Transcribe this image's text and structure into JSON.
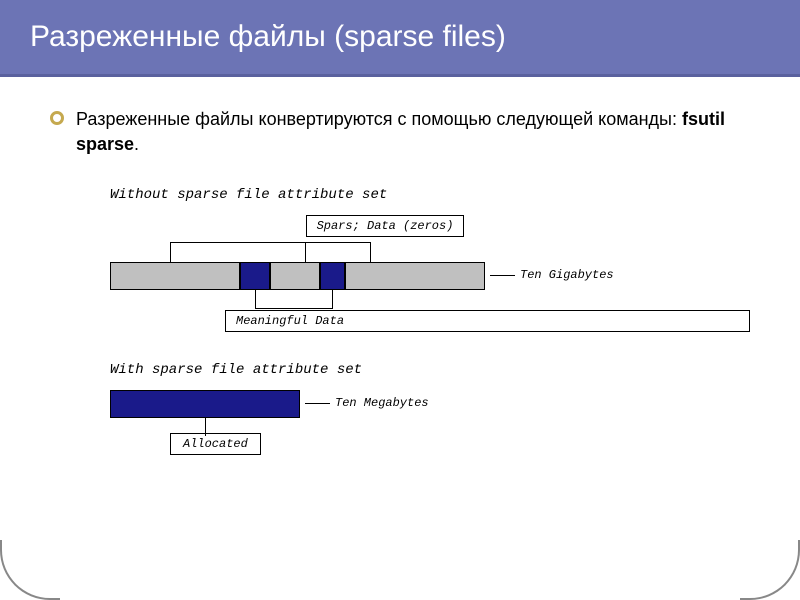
{
  "slide": {
    "title": "Разреженные файлы (sparse files)",
    "bullet_text_prefix": "Разреженные файлы конвертируются с помощью следующей команды: ",
    "bullet_text_bold": "fsutil sparse",
    "bullet_text_suffix": "."
  },
  "diagram": {
    "section1_title": "Without sparse file attribute set",
    "sparse_data_label": "Spars; Data (zeros)",
    "side_label1": "Ten Gigabytes",
    "meaningful_label": "Meaningful Data",
    "section2_title": "With sparse file attribute set",
    "side_label2": "Ten Megabytes",
    "allocated_label": "Allocated",
    "bar_segments": [
      {
        "type": "gray",
        "width": 130
      },
      {
        "type": "blue",
        "width": 30
      },
      {
        "type": "gray",
        "width": 50
      },
      {
        "type": "blue",
        "width": 25
      },
      {
        "type": "gray",
        "width": 140
      }
    ]
  }
}
